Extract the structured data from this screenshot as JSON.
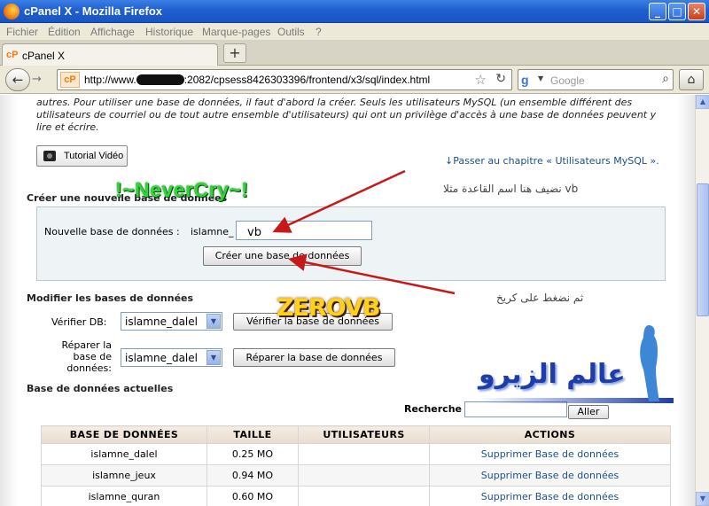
{
  "window": {
    "title": "cPanel X - Mozilla Firefox",
    "buttons": {
      "minimize": "_",
      "maximize": "□",
      "close": "✕"
    }
  },
  "menu": {
    "items": [
      "Fichier",
      "Édition",
      "Affichage",
      "Historique",
      "Marque-pages",
      "Outils",
      "?"
    ]
  },
  "tabs": {
    "active_label": "cPanel X",
    "new_tab": "+"
  },
  "navbar": {
    "url_prefix": "http://www.",
    "url_suffix": ":2082/cpsess8426303396/frontend/x3/sql/index.html",
    "search_placeholder": "Google"
  },
  "icons": {
    "back": "back-arrow-icon",
    "forward": "forward-arrow-icon",
    "bookmark": "star-icon",
    "reload": "reload-icon",
    "search": "magnifier-icon",
    "home": "home-icon",
    "camera": "camera-icon"
  },
  "page": {
    "intro_text": "autres. Pour utiliser une base de données, il faut d'abord la créer. Seuls les utilisateurs MySQL (un ensemble différent des utilisateurs de courriel ou de tout autre ensemble d'utilisateurs) qui ont un privilège d'accès à une base de données peuvent y lire et écrire.",
    "tutorial_button": "Tutorial Vidéo",
    "chapter_link": "↓Passer au chapitre « Utilisateurs MySQL ».",
    "create_section_title": "Créer une nouvelle base de données",
    "new_db_label": "Nouvelle base de données :",
    "db_prefix": "islamne_",
    "new_db_value": "vb",
    "create_button": "Créer une base de données",
    "modify_section_title": "Modifier les bases de données",
    "check_label": "Vérifier DB:",
    "check_select_value": "islamne_dalel",
    "check_button": "Vérifier la base de données",
    "repair_label_1": "Réparer la",
    "repair_label_2": "base de",
    "repair_label_3": "données:",
    "repair_select_value": "islamne_dalel",
    "repair_button": "Réparer la base de données",
    "current_section_title": "Base de données actuelles",
    "search_label": "Recherche",
    "search_value": "",
    "go_button": "Aller"
  },
  "table": {
    "headers": [
      "BASE DE DONNÉES",
      "TAILLE",
      "UTILISATEURS",
      "ACTIONS"
    ],
    "rows": [
      {
        "name": "islamne_dalel",
        "size": "0.25 MO",
        "users": "",
        "action": "Supprimer Base de données"
      },
      {
        "name": "islamne_jeux",
        "size": "0.94 MO",
        "users": "",
        "action": "Supprimer Base de données"
      },
      {
        "name": "islamne_quran",
        "size": "0.60 MO",
        "users": "",
        "action": "Supprimer Base de données"
      }
    ]
  },
  "overlays": {
    "watermark_1": "!~NeverCry~!",
    "watermark_2": "ZEROVB",
    "note_1": "vb  نضيف هنا اسم القاعدة مثلا",
    "note_2": "ثم نضغط على كريخ",
    "logo_text": "عالم الزيرو"
  },
  "colors": {
    "titlebar": "#1f5fd0",
    "link": "#1d4f8a",
    "arrow": "#c41a1a",
    "watermark_green": "#2fd33a",
    "watermark_yellow": "#ffd21a",
    "logo_blue": "#1f3da8"
  }
}
